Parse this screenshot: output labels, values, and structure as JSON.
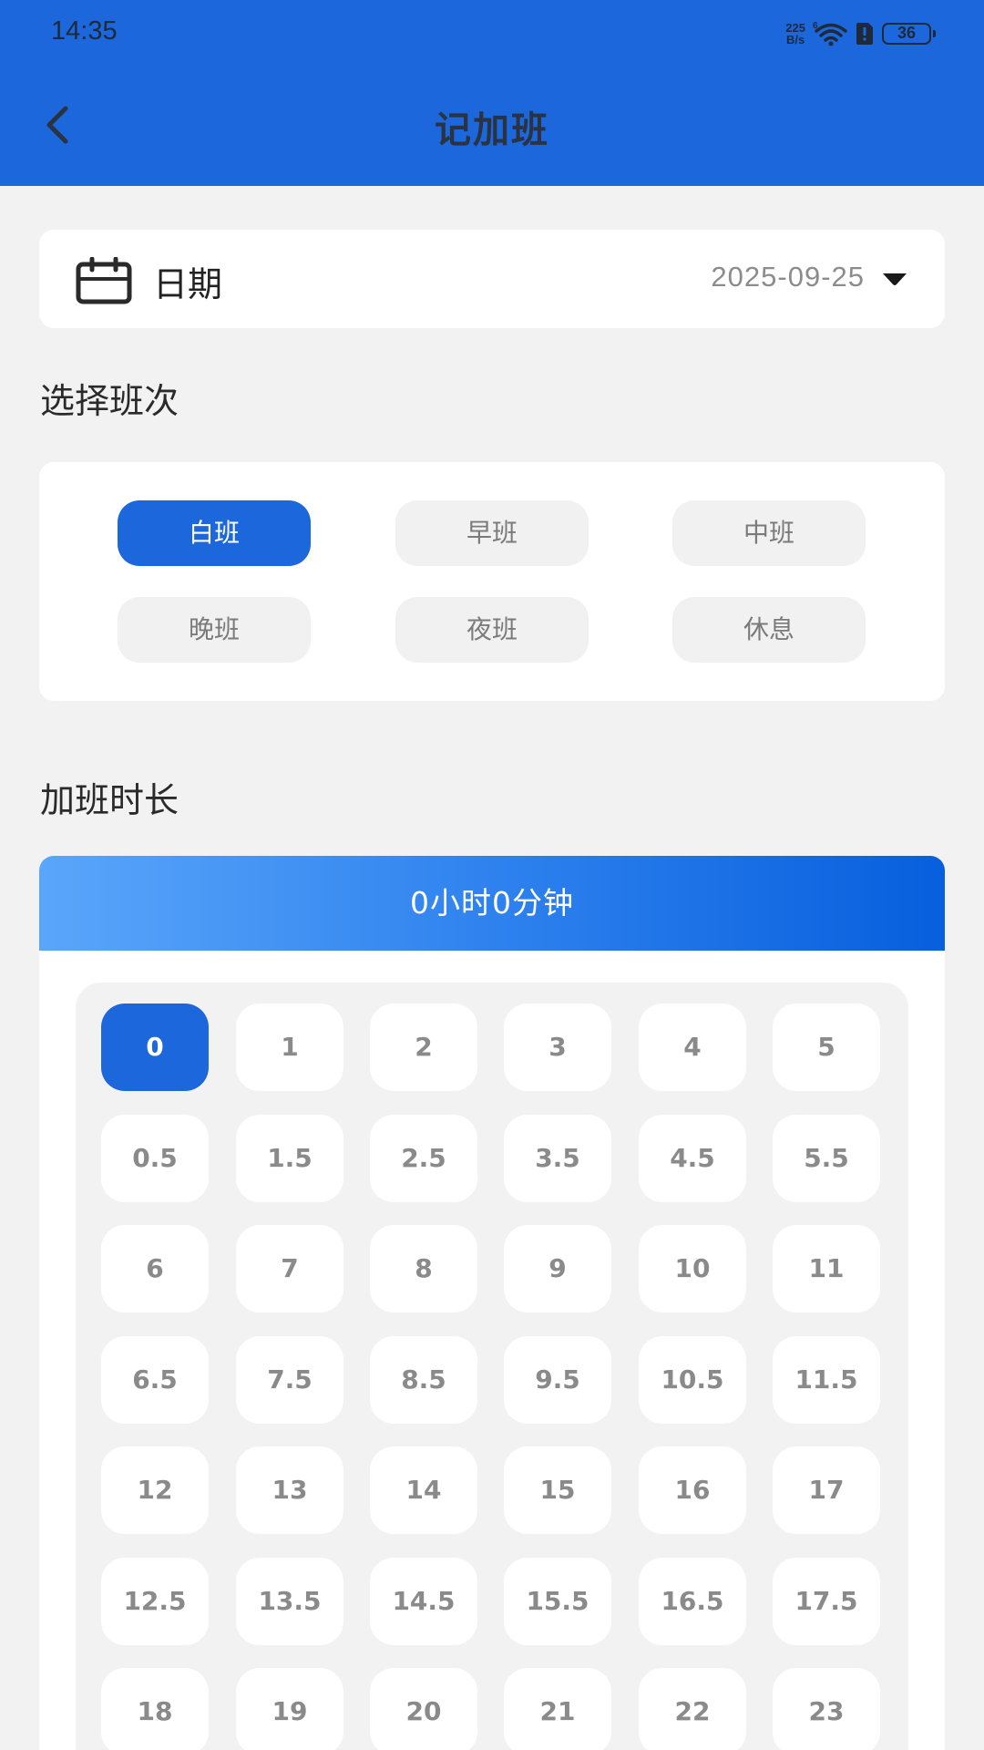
{
  "status_bar": {
    "time": "14:35",
    "net_speed_value": "225",
    "net_speed_unit": "B/s",
    "wifi_badge": "6",
    "battery": "36"
  },
  "header": {
    "title": "记加班",
    "back_icon": "chevron-left-icon",
    "background": "#1b67db"
  },
  "date": {
    "label": "日期",
    "value": "2025-09-25",
    "icon": "calendar-icon"
  },
  "shift_section": {
    "title": "选择班次",
    "selected": "白班",
    "options": [
      "白班",
      "早班",
      "中班",
      "晚班",
      "夜班",
      "休息"
    ]
  },
  "overtime_section": {
    "title": "加班时长",
    "summary": "0小时0分钟",
    "selected": "0",
    "hours": [
      "0",
      "1",
      "2",
      "3",
      "4",
      "5",
      "0.5",
      "1.5",
      "2.5",
      "3.5",
      "4.5",
      "5.5",
      "6",
      "7",
      "8",
      "9",
      "10",
      "11",
      "6.5",
      "7.5",
      "8.5",
      "9.5",
      "10.5",
      "11.5",
      "12",
      "13",
      "14",
      "15",
      "16",
      "17",
      "12.5",
      "13.5",
      "14.5",
      "15.5",
      "16.5",
      "17.5",
      "18",
      "19",
      "20",
      "21",
      "22",
      "23"
    ]
  },
  "colors": {
    "accent": "#1b67db",
    "page_bg": "#f2f2f2",
    "inactive_text": "#8a8a8a"
  }
}
